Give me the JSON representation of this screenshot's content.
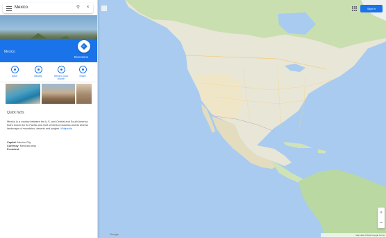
{
  "search": {
    "query": "Mexico"
  },
  "place": {
    "subtitle": "Mexico",
    "directions_label": "Directions"
  },
  "actions": [
    {
      "label": "Save",
      "icon": "bookmark-icon"
    },
    {
      "label": "Nearby",
      "icon": "nearby-icon"
    },
    {
      "label": "Send to your phone",
      "icon": "phone-icon"
    },
    {
      "label": "Share",
      "icon": "share-icon"
    }
  ],
  "about": {
    "title": "Quick facts",
    "description": "Mexico is a country between the U.S. and Central and South America that's known for its Pacific and Gulf of Mexico beaches and its diverse landscape of mountains, deserts and jungles.",
    "link": "Wikipedia",
    "facts": [
      {
        "label": "Capital",
        "value": "Mexico City"
      },
      {
        "label": "Currency",
        "value": "Mexican peso"
      },
      {
        "label": "President",
        "value": ""
      }
    ]
  },
  "header": {
    "sign_in": "Sign in"
  },
  "map": {
    "footer": "Map data ©2020 Google  Terms",
    "logo": "Google",
    "colors": {
      "water": "#a9cbf0",
      "land": "#e8e6d6",
      "forest": "#b9d8a2",
      "desert": "#efe6c8",
      "accent": "#1a73e8"
    }
  }
}
